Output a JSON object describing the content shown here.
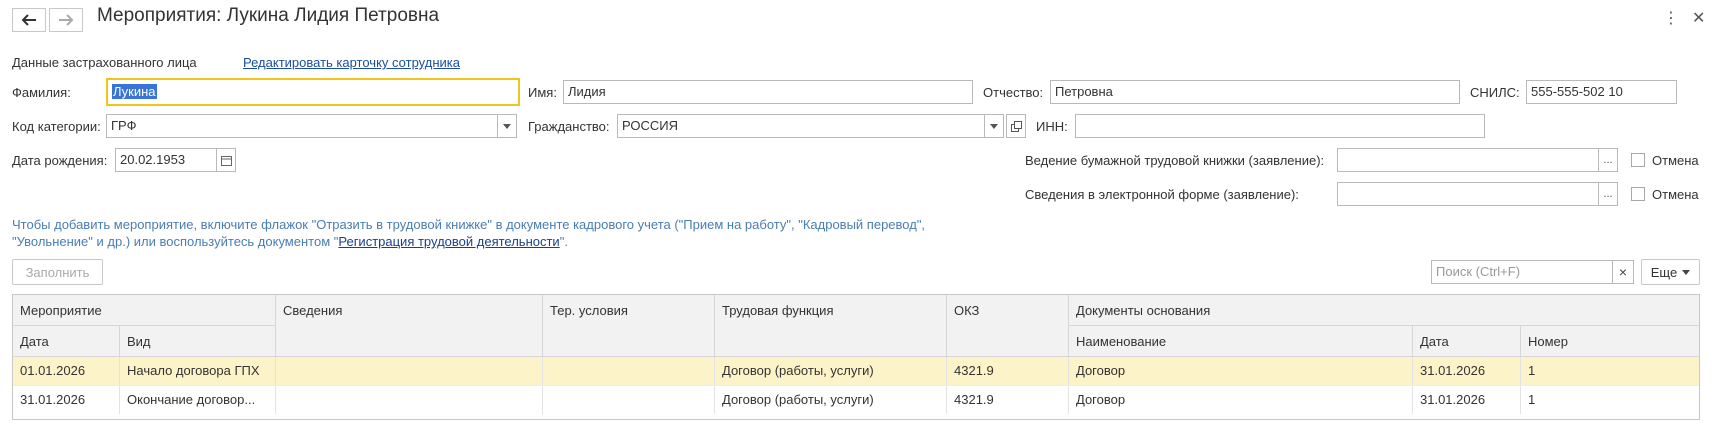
{
  "window": {
    "title": "Мероприятия: Лукина Лидия Петровна",
    "icons": {
      "back": "arrow-left-icon",
      "forward": "arrow-right-icon",
      "more": "more-vertical-icon",
      "close": "close-icon"
    }
  },
  "insured": {
    "section_label": "Данные застрахованного лица",
    "edit_link": "Редактировать карточку сотрудника",
    "surname_label": "Фамилия:",
    "surname_value": "Лукина",
    "name_label": "Имя:",
    "name_value": "Лидия",
    "patronymic_label": "Отчество:",
    "patronymic_value": "Петровна",
    "snils_label": "СНИЛС:",
    "snils_value": "555-555-502 10",
    "category_label": "Код категории:",
    "category_value": "ГРФ",
    "citizenship_label": "Гражданство:",
    "citizenship_value": "РОССИЯ",
    "inn_label": "ИНН:",
    "inn_value": "",
    "birth_label": "Дата рождения:",
    "birth_value": "20.02.1953",
    "paper_book_label": "Ведение бумажной трудовой книжки (заявление):",
    "paper_book_value": "",
    "electronic_label": "Сведения в электронной форме (заявление):",
    "electronic_value": "",
    "cancel_label": "Отмена",
    "cancel_label_2": "Отмена",
    "ellipsis": "..."
  },
  "info": {
    "text_before": "Чтобы добавить мероприятие, включите флажок \"Отразить в трудовой книжке\" в документе кадрового учета (\"Прием на работу\", \"Кадровый перевод\", \"Увольнение\" и др.) или воспользуйтесь документом \"",
    "link": "Регистрация трудовой деятельности",
    "text_after": "\"."
  },
  "toolbar": {
    "fill_button": "Заполнить",
    "search_placeholder": "Поиск (Ctrl+F)",
    "search_clear": "×",
    "more_button": "Еще"
  },
  "table": {
    "headers": {
      "event": "Мероприятие",
      "date": "Дата",
      "kind": "Вид",
      "info": "Сведения",
      "ter": "Тер. условия",
      "func": "Трудовая функция",
      "okz": "ОКЗ",
      "docs": "Документы основания",
      "doc_name": "Наименование",
      "doc_date": "Дата",
      "doc_num": "Номер"
    },
    "rows": [
      {
        "date": "01.01.2026",
        "kind": "Начало договора ГПХ",
        "info": "",
        "ter": "",
        "func": "Договор (работы, услуги)",
        "okz": "4321.9",
        "doc_name": "Договор",
        "doc_date": "31.01.2026",
        "doc_num": "1"
      },
      {
        "date": "31.01.2026",
        "kind": "Окончание договор...",
        "info": "",
        "ter": "",
        "func": "Договор (работы, услуги)",
        "okz": "4321.9",
        "doc_name": "Договор",
        "doc_date": "31.01.2026",
        "doc_num": "1"
      }
    ]
  },
  "colors": {
    "focus": "#f0c419",
    "selected_row": "#fdf3c8",
    "link": "#1a4fa0",
    "info": "#4a7db3"
  }
}
